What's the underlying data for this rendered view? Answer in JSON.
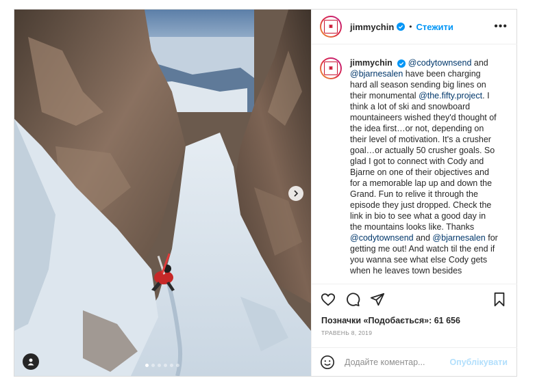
{
  "post": {
    "author": "jimmychin",
    "follow_label": "Стежити",
    "separator": "•",
    "more_label": "•••",
    "caption": {
      "author": "jimmychin",
      "segments": [
        {
          "type": "mention",
          "text": "@codytownsend"
        },
        {
          "type": "text",
          "text": " and "
        },
        {
          "type": "mention",
          "text": "@bjarnesalen"
        },
        {
          "type": "text",
          "text": " have been charging hard all season sending big lines on their monumental "
        },
        {
          "type": "mention",
          "text": "@the.fifty.project"
        },
        {
          "type": "text",
          "text": ". I think a lot of ski and snowboard mountaineers wished they'd thought of the idea first…or not, depending on their level of motivation. It's a crusher goal…or actually 50 crusher goals. So glad I got to connect with Cody and Bjarne on one of their objectives and for a memorable lap up and down the Grand. Fun to relive it through the episode they just dropped. Check the link in bio to see what a good day in the mountains looks like. Thanks "
        },
        {
          "type": "mention",
          "text": "@codytownsend"
        },
        {
          "type": "text",
          "text": " and "
        },
        {
          "type": "mention",
          "text": "@bjarnesalen"
        },
        {
          "type": "text",
          "text": " for getting me out! And watch til the end if you wanna see what else Cody gets when he leaves town besides"
        }
      ]
    },
    "likes_text": "Позначки «Подобається»: 61 656",
    "date_text": "ТРАВЕНЬ 8, 2019",
    "comment_placeholder": "Додайте коментар...",
    "publish_label": "Опублікувати",
    "carousel": {
      "total": 6,
      "active": 0
    }
  },
  "icons": {
    "like": "heart-icon",
    "comment": "comment-icon",
    "share": "share-icon",
    "save": "bookmark-icon",
    "emoji": "emoji-icon",
    "next": "chevron-right-icon",
    "tags": "user-tag-icon",
    "verified": "verified-badge-icon"
  },
  "colors": {
    "accent": "#0095f6",
    "publish_disabled": "#b2dffc",
    "mention": "#00376b",
    "meta": "#8e8e8e"
  }
}
